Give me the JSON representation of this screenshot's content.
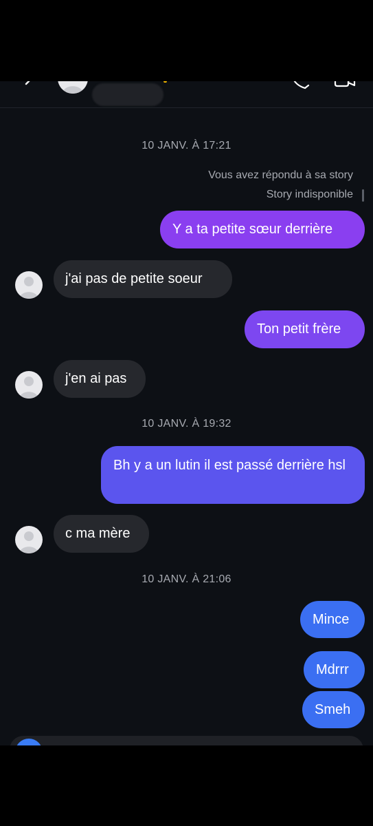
{
  "header": {
    "back_icon": "chevron-left-icon",
    "call_icon": "phone-icon",
    "video_icon": "video-camera-icon"
  },
  "conversation": {
    "timestamp_1": "10 JANV. À 17:21",
    "story_reply": "Vous avez répondu à sa story",
    "story_unavailable": "Story indisponible",
    "msg_1": "Y a ta petite sœur derrière",
    "msg_2": "j'ai pas de petite soeur",
    "msg_3": "Ton petit frère",
    "msg_4": "j'en ai pas",
    "timestamp_2": "10 JANV. À 19:32",
    "msg_5": "Bh y a un lutin il est passé derrière hsl",
    "msg_6": "c ma mère",
    "timestamp_3": "10 JANV. À 21:06",
    "msg_7": "Mince",
    "msg_8": "Mdrrr",
    "msg_9": "Smeh"
  },
  "colors": {
    "background": "#0d1015",
    "incoming_bubble": "#26282d",
    "outgoing_purple": "#8a3ff0",
    "outgoing_indigo": "#5b55ee",
    "outgoing_blue": "#3b6ff2",
    "muted_text": "#a7aab1"
  }
}
